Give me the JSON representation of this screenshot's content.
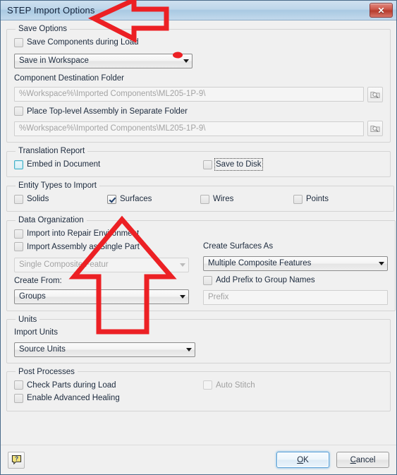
{
  "window": {
    "title": "STEP Import Options",
    "close_label": "×",
    "close_icon": "close-icon"
  },
  "sections": {
    "save_options": {
      "legend": "Save Options",
      "save_components_checkbox": {
        "label": "Save Components during Load",
        "checked": false
      },
      "save_location_combo": {
        "value": "Save in Workspace"
      },
      "destination_label": "Component Destination Folder",
      "destination_path": "%Workspace%\\Imported Components\\ML205-1P-9\\",
      "place_toplevel_checkbox": {
        "label": "Place Top-level Assembly in Separate Folder",
        "checked": false
      },
      "separate_folder_path": "%Workspace%\\Imported Components\\ML205-1P-9\\",
      "browse_icon": "folder-search-icon"
    },
    "translation_report": {
      "legend": "Translation Report",
      "embed_checkbox": {
        "label": "Embed in Document",
        "checked": false,
        "state": "hover"
      },
      "save_to_disk_checkbox": {
        "label": "Save to Disk",
        "checked": false,
        "state": "focused"
      }
    },
    "entity_types": {
      "legend": "Entity Types to Import",
      "items": [
        {
          "label": "Solids",
          "checked": false
        },
        {
          "label": "Surfaces",
          "checked": true
        },
        {
          "label": "Wires",
          "checked": false
        },
        {
          "label": "Points",
          "checked": false
        }
      ]
    },
    "data_organization": {
      "legend": "Data Organization",
      "repair_env_checkbox": {
        "label": "Import into Repair Environment",
        "checked": false
      },
      "single_part_checkbox": {
        "label": "Import Assembly as Single Part",
        "checked": false
      },
      "composite_combo": {
        "value": "Single Composite Featur",
        "disabled": true
      },
      "create_from_label": "Create From:",
      "create_from_combo": {
        "value": "Groups"
      },
      "create_surfaces_label": "Create Surfaces As",
      "create_surfaces_combo": {
        "value": "Multiple Composite Features"
      },
      "add_prefix_checkbox": {
        "label": "Add Prefix to Group Names",
        "checked": false
      },
      "prefix_input": {
        "value": "",
        "placeholder": "Prefix"
      }
    },
    "units": {
      "legend": "Units",
      "import_units_label": "Import Units",
      "import_units_combo": {
        "value": "Source Units"
      }
    },
    "post_processes": {
      "legend": "Post Processes",
      "check_parts_checkbox": {
        "label": "Check Parts during Load",
        "checked": false
      },
      "enable_healing_checkbox": {
        "label": "Enable Advanced Healing",
        "checked": false
      },
      "auto_stitch_checkbox": {
        "label": "Auto Stitch",
        "checked": false,
        "disabled": true
      }
    }
  },
  "footer": {
    "help_icon": "help-question-icon",
    "ok_label": "OK",
    "ok_accel": "O",
    "cancel_label": "Cancel",
    "cancel_accel": "C"
  },
  "annotations": {
    "accent_color": "#ec2024",
    "left_arrow": "arrow pointing left at the title bar",
    "up_arrow": "arrow pointing up at the Surfaces checkbox",
    "dot": "red dot marker above the Save in Workspace dropdown arrow"
  }
}
